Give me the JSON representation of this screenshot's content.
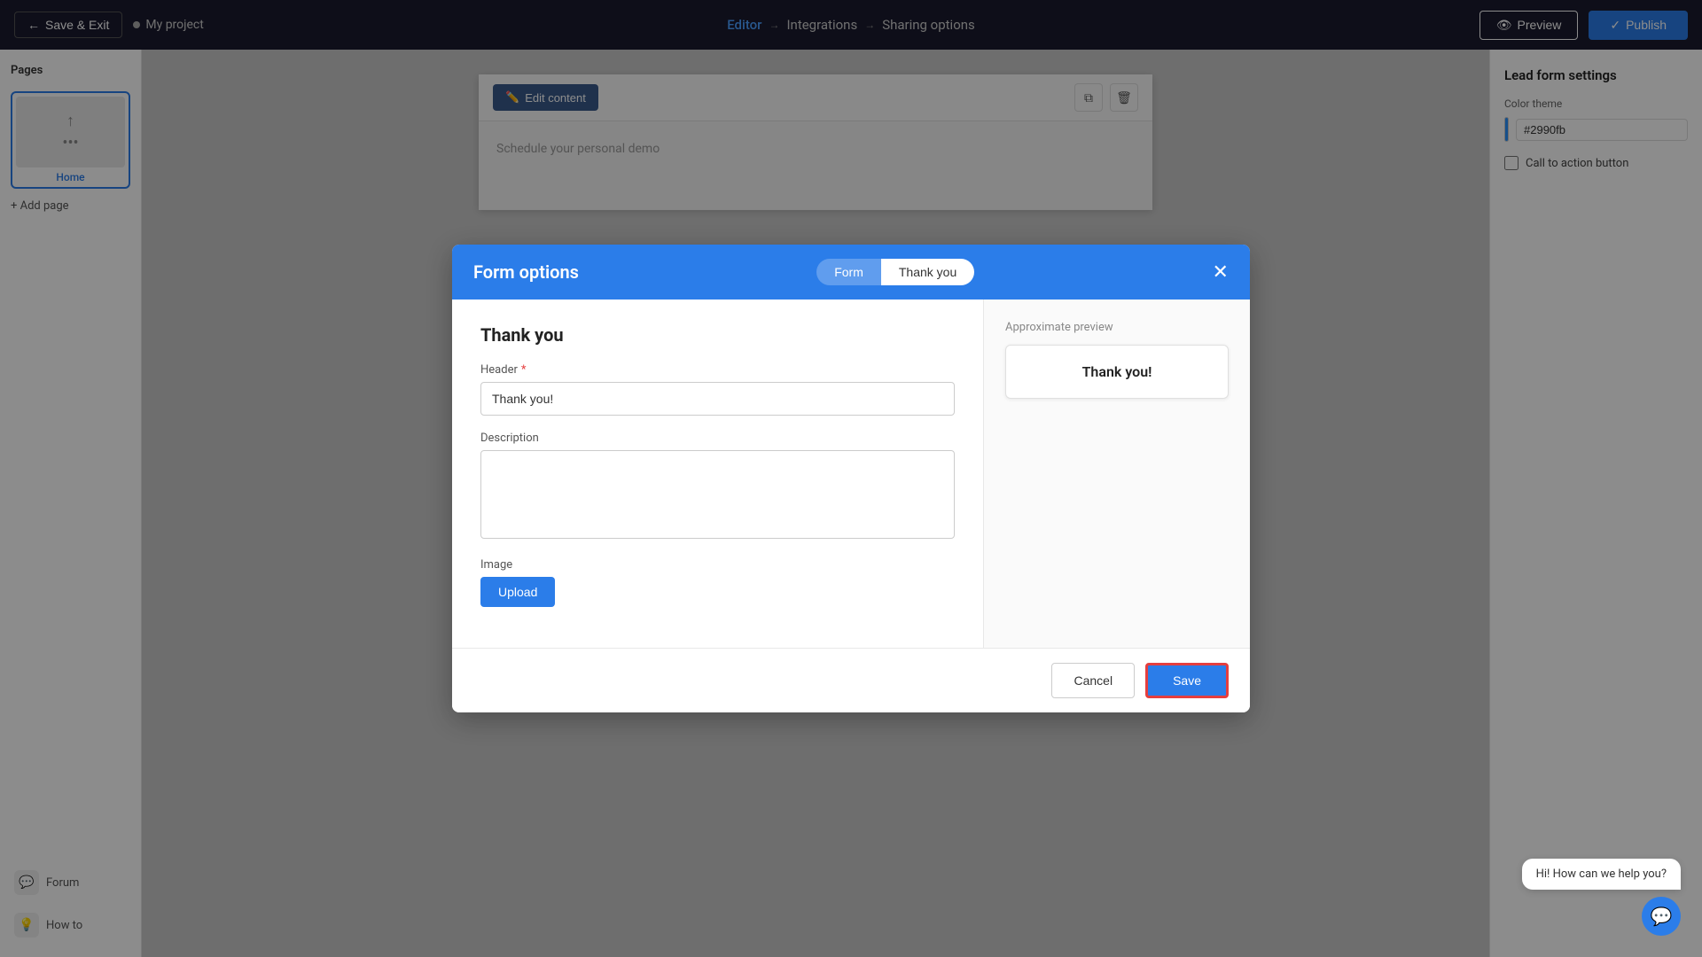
{
  "topNav": {
    "saveExitLabel": "Save & Exit",
    "projectName": "My project",
    "editorLink": "Editor",
    "integrationsLink": "Integrations",
    "sharingOptionsLink": "Sharing options",
    "previewLabel": "Preview",
    "publishLabel": "Publish"
  },
  "sidebar": {
    "title": "Pages",
    "homePage": "Home",
    "addPageLabel": "+ Add page",
    "bottomItems": [
      {
        "label": "Forum",
        "icon": "💬"
      },
      {
        "label": "How to",
        "icon": "💡"
      }
    ]
  },
  "canvas": {
    "editContentLabel": "Edit content",
    "bodyText": "Schedule your personal demo"
  },
  "rightPanel": {
    "title": "Lead form settings",
    "colorThemeLabel": "Color theme",
    "colorValue": "#2990fb",
    "ctaLabel": "Call to action button"
  },
  "modal": {
    "title": "Form options",
    "tabForm": "Form",
    "tabThankYou": "Thank you",
    "sectionTitle": "Thank you",
    "headerLabel": "Header",
    "headerRequired": true,
    "headerValue": "Thank you!",
    "descriptionLabel": "Description",
    "descriptionValue": "",
    "imageLabel": "Image",
    "uploadLabel": "Upload",
    "previewLabel": "Approximate preview",
    "previewText": "Thank you!",
    "cancelLabel": "Cancel",
    "saveLabel": "Save"
  },
  "chat": {
    "message": "Hi! How can we help you?",
    "icon": "💬"
  }
}
